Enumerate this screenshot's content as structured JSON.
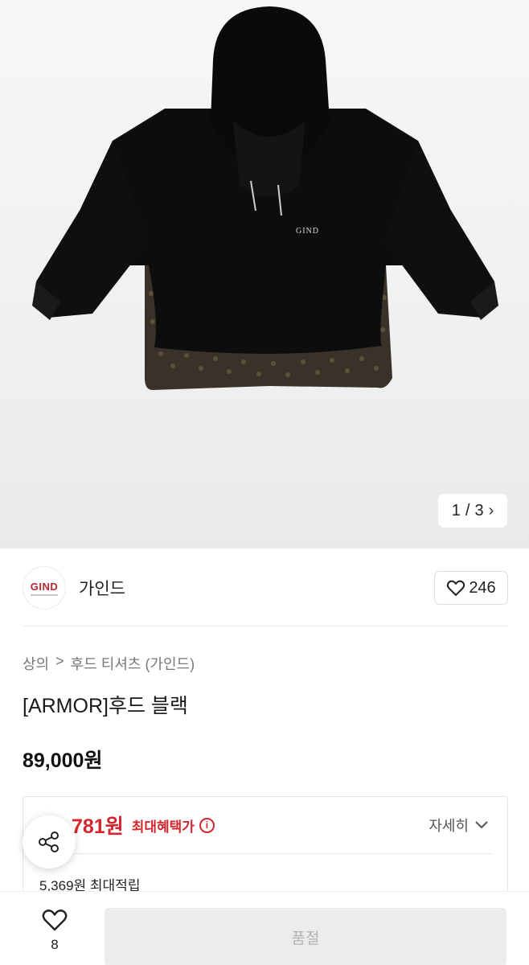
{
  "gallery": {
    "current": "1",
    "separator": "/",
    "total": "3",
    "next_icon": "chevron-right-icon",
    "hoodie_print": "GIND"
  },
  "brand": {
    "logo_text": "GIND",
    "name": "가인드",
    "like_count": "246",
    "like_icon": "heart-outline-icon"
  },
  "breadcrumb": {
    "category": "상의",
    "separator": ">",
    "subcategory": "후드 티셔츠 (가인드)"
  },
  "product": {
    "title": "[ARMOR]후드 블랙",
    "price": "89,000원"
  },
  "benefit": {
    "price": "781원",
    "label": "최대혜택가",
    "info_icon": "info-icon",
    "detail_label": "자세히",
    "points": "5,369원 최대적립"
  },
  "actions": {
    "share_icon": "share-icon",
    "wish_count": "8",
    "buy_label": "품절"
  },
  "colors": {
    "accent_red": "#d3262f",
    "disabled_bg": "#ececec"
  }
}
